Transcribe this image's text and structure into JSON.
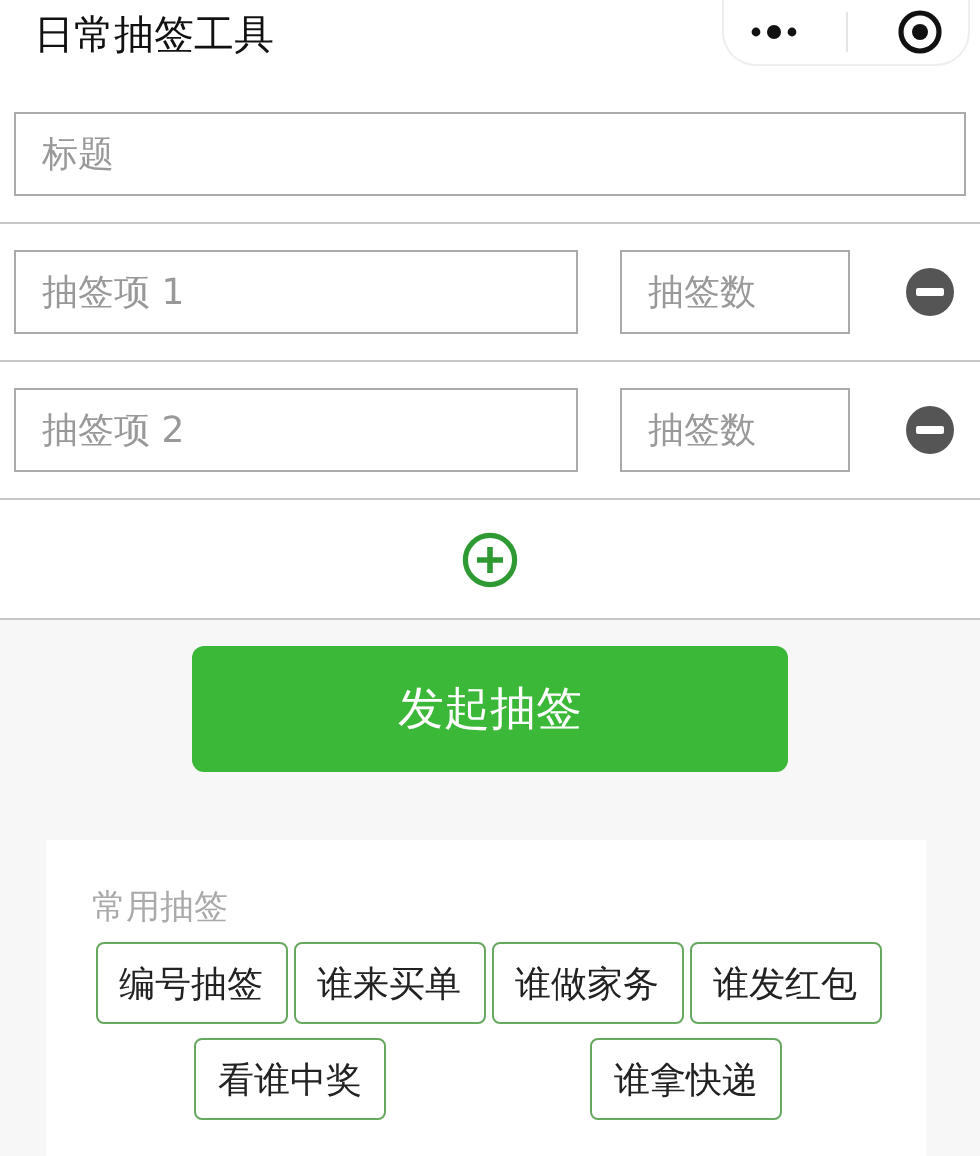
{
  "header": {
    "title": "日常抽签工具"
  },
  "title_field": {
    "placeholder": "标题"
  },
  "items": [
    {
      "placeholder": "抽签项 1",
      "count_placeholder": "抽签数"
    },
    {
      "placeholder": "抽签项 2",
      "count_placeholder": "抽签数"
    }
  ],
  "submit_button": {
    "label": "发起抽签"
  },
  "presets": {
    "heading": "常用抽签",
    "chips": [
      "编号抽签",
      "谁来买单",
      "谁做家务",
      "谁发红包",
      "看谁中奖",
      "谁拿快递"
    ]
  }
}
